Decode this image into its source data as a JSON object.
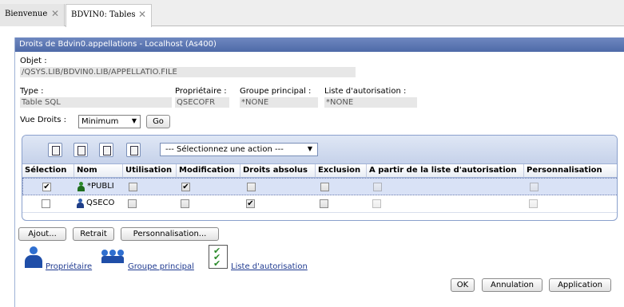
{
  "tabs": [
    {
      "label": "Bienvenue",
      "close": "✕"
    },
    {
      "label": "BDVIN0: Tables",
      "close": "✕"
    }
  ],
  "dialog": {
    "title": "Droits de Bdvin0.appellations - Localhost (As400)",
    "object_label": "Objet :",
    "object_value": "/QSYS.LIB/BDVIN0.LIB/APPELLATIO.FILE",
    "type_label": "Type :",
    "type_value": "Table SQL",
    "owner_label": "Propriétaire :",
    "owner_value": "QSECOFR",
    "group_label": "Groupe principal :",
    "group_value": "*NONE",
    "authlist_label": "Liste d'autorisation :",
    "authlist_value": "*NONE",
    "view_label": "Vue Droits :",
    "view_value": "Minimum",
    "go_button": "Go"
  },
  "table": {
    "action_select": "--- Sélectionnez une action ---",
    "columns": [
      "Sélection",
      "Nom",
      "Utilisation",
      "Modification",
      "Droits absolus",
      "Exclusion",
      "A partir de la liste d'autorisation",
      "Personnalisation"
    ],
    "rows": [
      {
        "name": "*PUBLI",
        "selected": true,
        "utilisation": false,
        "modification": true,
        "droits_absolus": false,
        "exclusion": false,
        "from_list": false,
        "personnalisation": false
      },
      {
        "name": "QSECO",
        "selected": false,
        "utilisation": false,
        "modification": false,
        "droits_absolus": true,
        "exclusion": false,
        "from_list": false,
        "personnalisation": false
      }
    ]
  },
  "buttons": {
    "add": "Ajout...",
    "remove": "Retrait",
    "customize": "Personnalisation...",
    "ok": "OK",
    "cancel": "Annulation",
    "apply": "Application"
  },
  "legend": {
    "owner": "Propriétaire",
    "group": "Groupe principal",
    "authlist": "Liste d'autorisation"
  }
}
